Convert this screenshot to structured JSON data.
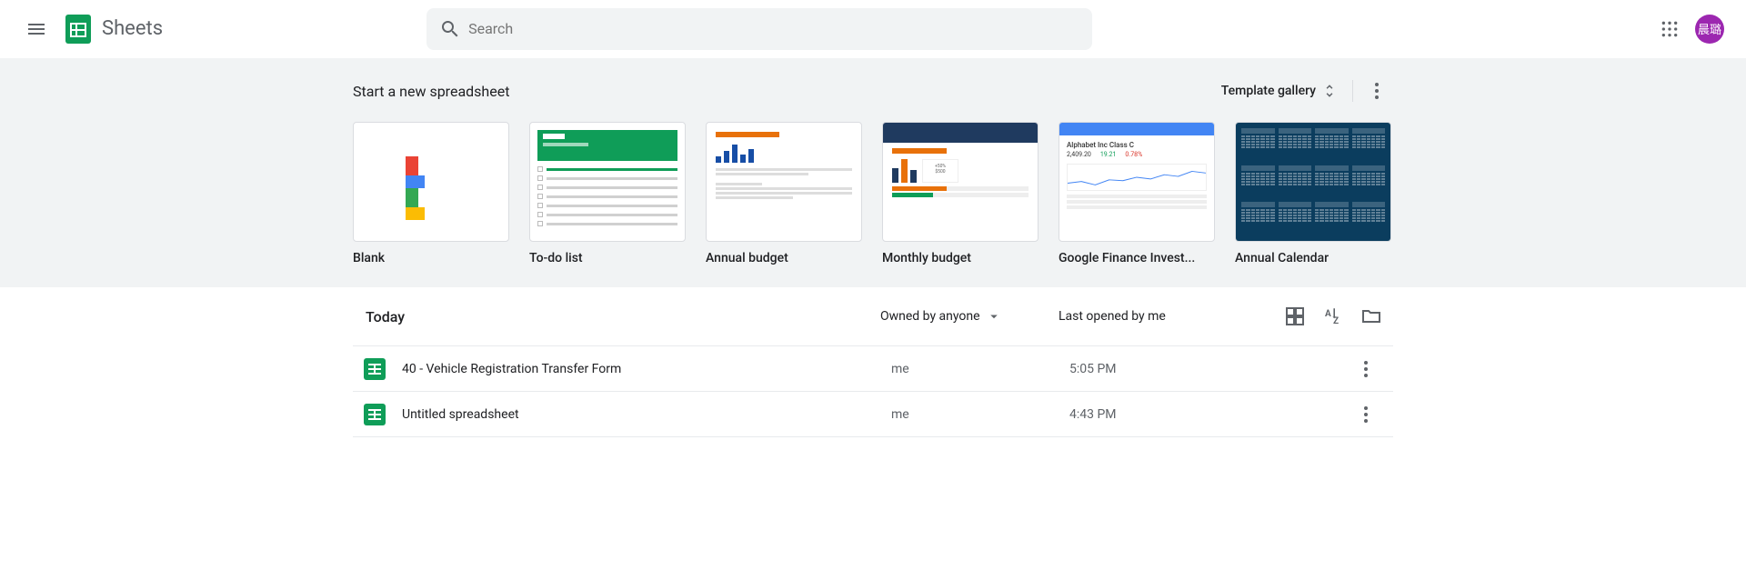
{
  "header": {
    "app_title": "Sheets",
    "search_placeholder": "Search",
    "avatar_text": "晨璐"
  },
  "template_strip": {
    "title": "Start a new spreadsheet",
    "gallery_label": "Template gallery",
    "items": [
      {
        "label": "Blank"
      },
      {
        "label": "To-do list"
      },
      {
        "label": "Annual budget"
      },
      {
        "label": "Monthly budget"
      },
      {
        "label": "Google Finance Invest..."
      },
      {
        "label": "Annual Calendar"
      }
    ],
    "finance_preview": {
      "name": "Alphabet Inc Class C",
      "price": "2,409.20",
      "change_up": "19.21",
      "change_dn": "0.78%"
    },
    "monthly_preview": {
      "pct": "+50%",
      "amount": "$500"
    }
  },
  "doc_list": {
    "section_title": "Today",
    "owner_filter": "Owned by anyone",
    "sort_label": "Last opened by me",
    "rows": [
      {
        "name": "40 - Vehicle Registration Transfer Form",
        "owner": "me",
        "time": "5:05 PM"
      },
      {
        "name": "Untitled spreadsheet",
        "owner": "me",
        "time": "4:43 PM"
      }
    ]
  }
}
